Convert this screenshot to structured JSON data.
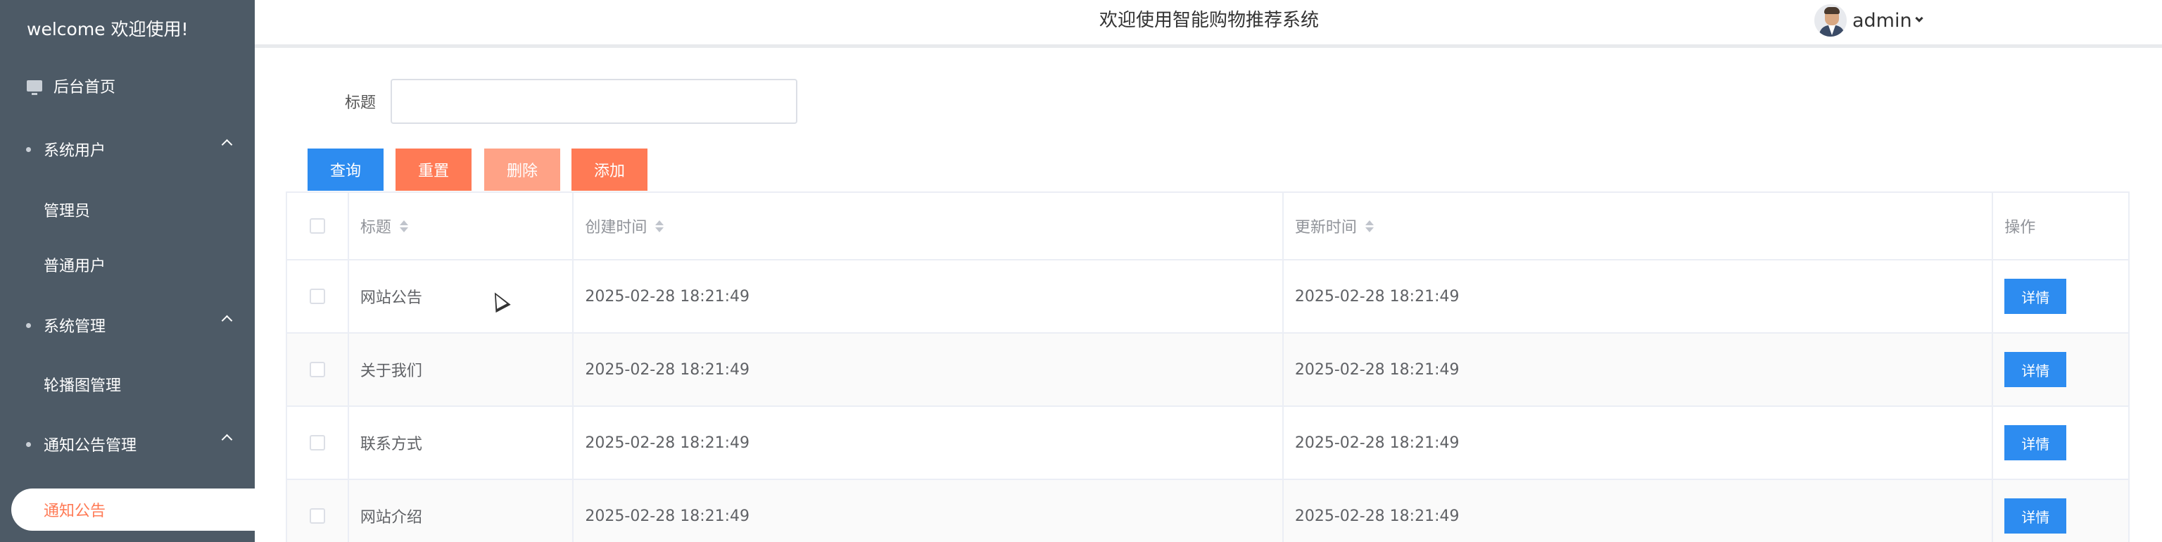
{
  "sidebar": {
    "welcome": "welcome 欢迎使用!",
    "home": "后台首页",
    "groups": [
      {
        "label": "系统用户",
        "items": [
          "管理员",
          "普通用户"
        ]
      },
      {
        "label": "系统管理",
        "items": [
          "轮播图管理"
        ]
      },
      {
        "label": "通知公告管理",
        "items": [
          "通知公告"
        ]
      }
    ],
    "active_item": "通知公告"
  },
  "topbar": {
    "title": "欢迎使用智能购物推荐系统",
    "username": "admin"
  },
  "search": {
    "label": "标题",
    "value": "",
    "placeholder": ""
  },
  "buttons": {
    "query": "查询",
    "reset": "重置",
    "delete": "删除",
    "add": "添加"
  },
  "table": {
    "columns": [
      "标题",
      "创建时间",
      "更新时间",
      "操作"
    ],
    "rows": [
      {
        "title": "网站公告",
        "created": "2025-02-28 18:21:49",
        "updated": "2025-02-28 18:21:49",
        "action": "详情"
      },
      {
        "title": "关于我们",
        "created": "2025-02-28 18:21:49",
        "updated": "2025-02-28 18:21:49",
        "action": "详情"
      },
      {
        "title": "联系方式",
        "created": "2025-02-28 18:21:49",
        "updated": "2025-02-28 18:21:49",
        "action": "详情"
      },
      {
        "title": "网站介绍",
        "created": "2025-02-28 18:21:49",
        "updated": "2025-02-28 18:21:49",
        "action": "详情"
      }
    ]
  },
  "colors": {
    "sidebar_bg": "#4d5a66",
    "primary": "#2d8cf0",
    "accent": "#ff7a55",
    "accent_light": "#ffa286"
  }
}
